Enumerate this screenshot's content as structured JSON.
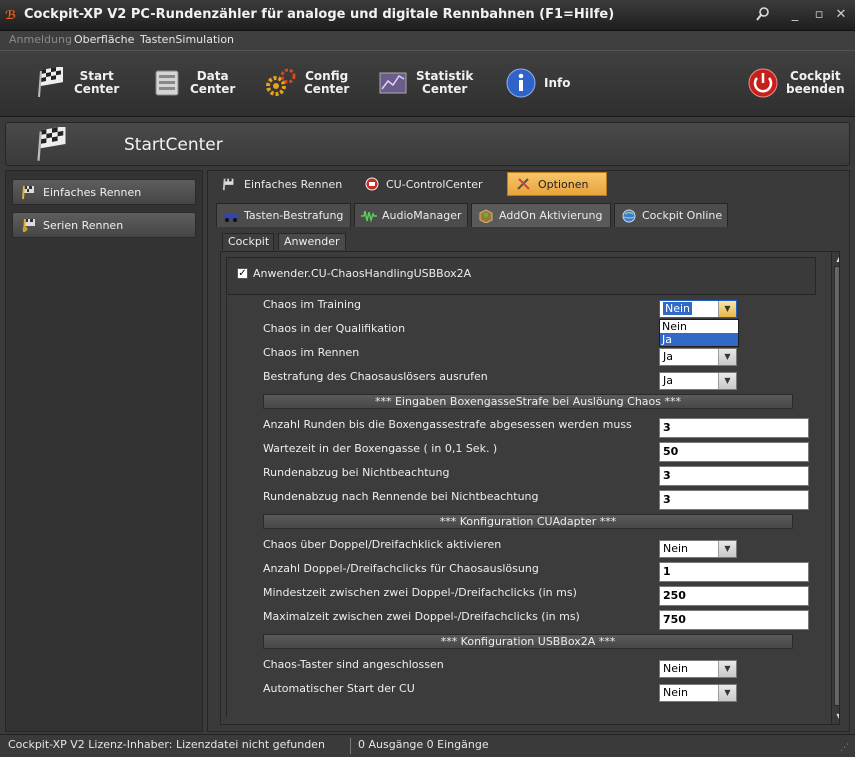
{
  "window": {
    "title": "Cockpit-XP V2 PC-Rundenzähler für analoge und digitale Rennbahnen (F1=Hilfe)"
  },
  "menu": [
    {
      "label": "Anmeldung",
      "enabled": false
    },
    {
      "label": "Oberfläche",
      "enabled": true
    },
    {
      "label": "TastenSimulation",
      "enabled": true
    }
  ],
  "toolbar": {
    "start_center": "Start\nCenter",
    "data_center": "Data\nCenter",
    "config_center": "Config\nCenter",
    "statistik_center": "Statistik\nCenter",
    "info": "Info",
    "cockpit_beenden": "Cockpit\nbeenden"
  },
  "header": {
    "title": "StartCenter"
  },
  "sidebar": {
    "items": [
      {
        "label": "Einfaches Rennen"
      },
      {
        "label": "Serien Rennen"
      }
    ]
  },
  "top_tabs": [
    {
      "label": "Einfaches Rennen"
    },
    {
      "label": "CU-ControlCenter"
    },
    {
      "label": "Optionen",
      "active": true
    }
  ],
  "sub_tabs": [
    {
      "label": "Tasten-Bestrafung"
    },
    {
      "label": "AudioManager"
    },
    {
      "label": "AddOn Aktivierung",
      "active": true
    },
    {
      "label": "Cockpit Online"
    }
  ],
  "inner_tabs": [
    {
      "label": "Cockpit"
    },
    {
      "label": "Anwender",
      "active": true
    }
  ],
  "plugin": {
    "checked": true,
    "label": "Anwender.CU-ChaosHandlingUSBBox2A"
  },
  "settings": {
    "chaos_training": {
      "label": "Chaos im Training",
      "value": "Nein",
      "options": [
        "Nein",
        "Ja"
      ],
      "highlighted_option": "Ja"
    },
    "chaos_qualifikation": {
      "label": "Chaos in der Qualifikation"
    },
    "chaos_rennen": {
      "label": "Chaos im Rennen",
      "value": "Ja"
    },
    "bestrafung": {
      "label": "Bestrafung des Chaosauslösers ausrufen",
      "value": "Ja"
    },
    "section_boxengasse": "*** Eingaben BoxengasseStrafe bei Auslöung Chaos ***",
    "anzahl_runden": {
      "label": "Anzahl Runden bis die Boxengassestrafe abgesessen werden muss",
      "value": "3"
    },
    "wartezeit": {
      "label": "Wartezeit in der Boxengasse  ( in 0,1 Sek. )",
      "value": "50"
    },
    "rundenabzug": {
      "label": "Rundenabzug bei Nichtbeachtung",
      "value": "3"
    },
    "rundenabzug_nach": {
      "label": "Rundenabzug nach Rennende bei Nichtbeachtung",
      "value": "3"
    },
    "section_cuadapter": "*** Konfiguration CUAdapter ***",
    "doppelklick": {
      "label": "Chaos über Doppel/Dreifachklick aktivieren",
      "value": "Nein"
    },
    "anzahl_clicks": {
      "label": "Anzahl Doppel-/Dreifachclicks für Chaosauslösung",
      "value": "1"
    },
    "mindestzeit": {
      "label": "Mindestzeit zwischen zwei Doppel-/Dreifachclicks (in ms)",
      "value": "250"
    },
    "maximalzeit": {
      "label": "Maximalzeit zwischen zwei Doppel-/Dreifachclicks (in ms)",
      "value": "750"
    },
    "section_usbbox": "*** Konfiguration USBBox2A ***",
    "taster": {
      "label": "Chaos-Taster sind angeschlossen",
      "value": "Nein"
    },
    "autostart": {
      "label": "Automatischer Start der CU",
      "value": "Nein"
    }
  },
  "status": {
    "license": "Cockpit-XP V2 Lizenz-Inhaber: Lizenzdatei nicht gefunden",
    "io": "0 Ausgänge 0 Eingänge"
  },
  "colors": {
    "accent_tab": "#e9a33b",
    "selection": "#3169c6"
  }
}
